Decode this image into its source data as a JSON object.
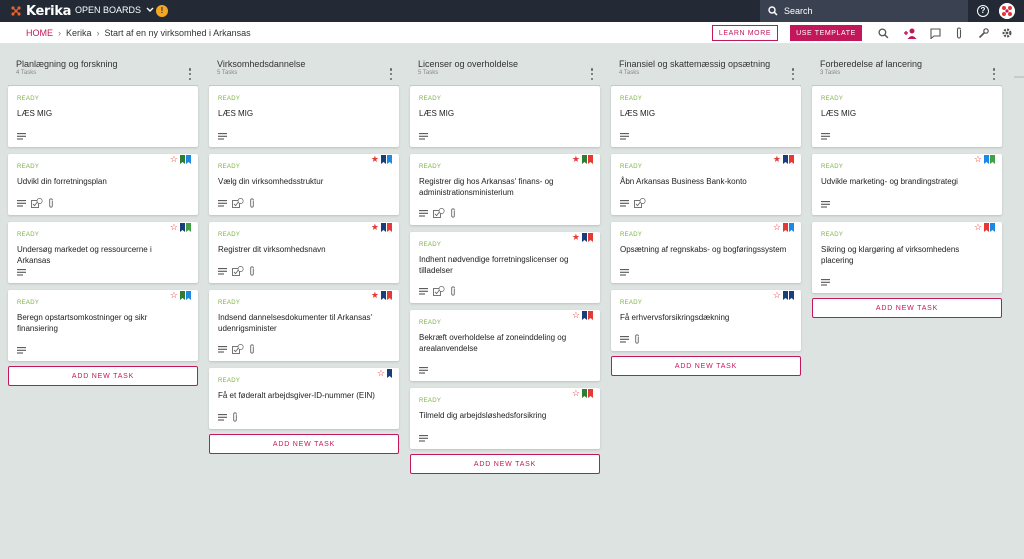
{
  "app": {
    "name": "Kerika",
    "open_boards": "OPEN BOARDS",
    "notif": "!"
  },
  "search": {
    "placeholder": "Search"
  },
  "help": "?",
  "breadcrumb": {
    "home": "HOME",
    "org": "Kerika",
    "board": "Start af en ny virksomhed i Arkansas"
  },
  "actions": {
    "learn_more": "LEARN MORE",
    "use_template": "USE TEMPLATE"
  },
  "colors": {
    "accent": "#c2185b",
    "ready": "#7cb342",
    "star": "#e53935",
    "red": "#e53935",
    "blue": "#1e88e5",
    "navy": "#1a3d7c",
    "green": "#43a047",
    "darkgreen": "#2e7d32",
    "teal": "#1e88e5"
  },
  "add_task_label": "ADD NEW TASK",
  "columns": [
    {
      "title": "Planlægning og forskning",
      "count": "4 Tasks",
      "cards": [
        {
          "status": "READY",
          "title": "LÆS MIG",
          "star": false,
          "flags": [],
          "checklist": null,
          "attach": false
        },
        {
          "status": "READY",
          "title": "Udvikl din forretningsplan",
          "star": "outline",
          "flags": [
            "darkgreen",
            "blue"
          ],
          "checklist": "1",
          "attach": true
        },
        {
          "status": "READY",
          "title": "Undersøg markedet og ressourcerne i Arkansas",
          "star": "outline",
          "flags": [
            "navy",
            "green"
          ],
          "checklist": null,
          "attach": false
        },
        {
          "status": "READY",
          "title": "Beregn opstartsomkostninger og sikr finansiering",
          "star": "outline",
          "flags": [
            "darkgreen",
            "blue"
          ],
          "checklist": null,
          "attach": false
        }
      ]
    },
    {
      "title": "Virksomhedsdannelse",
      "count": "5 Tasks",
      "cards": [
        {
          "status": "READY",
          "title": "LÆS MIG",
          "star": false,
          "flags": [],
          "checklist": null,
          "attach": false
        },
        {
          "status": "READY",
          "title": "Vælg din virksomhedsstruktur",
          "star": "filled",
          "flags": [
            "navy",
            "blue"
          ],
          "checklist": "4",
          "attach": true
        },
        {
          "status": "READY",
          "title": "Registrer dit virksomhedsnavn",
          "star": "filled",
          "flags": [
            "navy",
            "red"
          ],
          "checklist": "2",
          "attach": true
        },
        {
          "status": "READY",
          "title": "Indsend dannelsesdokumenter til Arkansas' udenrigsminister",
          "star": "filled",
          "flags": [
            "navy",
            "red"
          ],
          "checklist": "2",
          "attach": true
        },
        {
          "status": "READY",
          "title": "Få et føderalt arbejdsgiver-ID-nummer (EIN)",
          "star": "outline",
          "flags": [
            "navy"
          ],
          "checklist": null,
          "attach": true
        }
      ]
    },
    {
      "title": "Licenser og overholdelse",
      "count": "5 Tasks",
      "cards": [
        {
          "status": "READY",
          "title": "LÆS MIG",
          "star": false,
          "flags": [],
          "checklist": null,
          "attach": false
        },
        {
          "status": "READY",
          "title": "Registrer dig hos Arkansas' finans- og administrationsministerium",
          "star": "filled",
          "flags": [
            "darkgreen",
            "red"
          ],
          "checklist": "4",
          "attach": true
        },
        {
          "status": "READY",
          "title": "Indhent nødvendige forretningslicenser og tilladelser",
          "star": "filled",
          "flags": [
            "navy",
            "red"
          ],
          "checklist": "6",
          "attach": true
        },
        {
          "status": "READY",
          "title": "Bekræft overholdelse af zoneinddeling og arealanvendelse",
          "star": "outline",
          "flags": [
            "navy",
            "red"
          ],
          "checklist": null,
          "attach": false
        },
        {
          "status": "READY",
          "title": "Tilmeld dig arbejdsløshedsforsikring",
          "star": "outline",
          "flags": [
            "darkgreen",
            "red"
          ],
          "checklist": null,
          "attach": false
        }
      ]
    },
    {
      "title": "Finansiel og skattemæssig opsætning",
      "count": "4 Tasks",
      "cards": [
        {
          "status": "READY",
          "title": "LÆS MIG",
          "star": false,
          "flags": [],
          "checklist": null,
          "attach": false
        },
        {
          "status": "READY",
          "title": "Åbn Arkansas Business Bank-konto",
          "star": "filled",
          "flags": [
            "navy",
            "red"
          ],
          "checklist": "4",
          "attach": false
        },
        {
          "status": "READY",
          "title": "Opsætning af regnskabs- og bogføringssystem",
          "star": "outline",
          "flags": [
            "red",
            "blue"
          ],
          "checklist": null,
          "attach": false
        },
        {
          "status": "READY",
          "title": "Få erhvervsforsikringsdækning",
          "star": "outline",
          "flags": [
            "navy",
            "navy"
          ],
          "checklist": null,
          "attach": true
        }
      ]
    },
    {
      "title": "Forberedelse af lancering",
      "count": "3 Tasks",
      "cards": [
        {
          "status": "READY",
          "title": "LÆS MIG",
          "star": false,
          "flags": [],
          "checklist": null,
          "attach": false
        },
        {
          "status": "READY",
          "title": "Udvikle marketing- og brandingstrategi",
          "star": "outline",
          "flags": [
            "blue",
            "green"
          ],
          "checklist": null,
          "attach": false
        },
        {
          "status": "READY",
          "title": "Sikring og klargøring af virksomhedens placering",
          "star": "outline",
          "flags": [
            "red",
            "blue"
          ],
          "checklist": null,
          "attach": false
        }
      ]
    }
  ]
}
